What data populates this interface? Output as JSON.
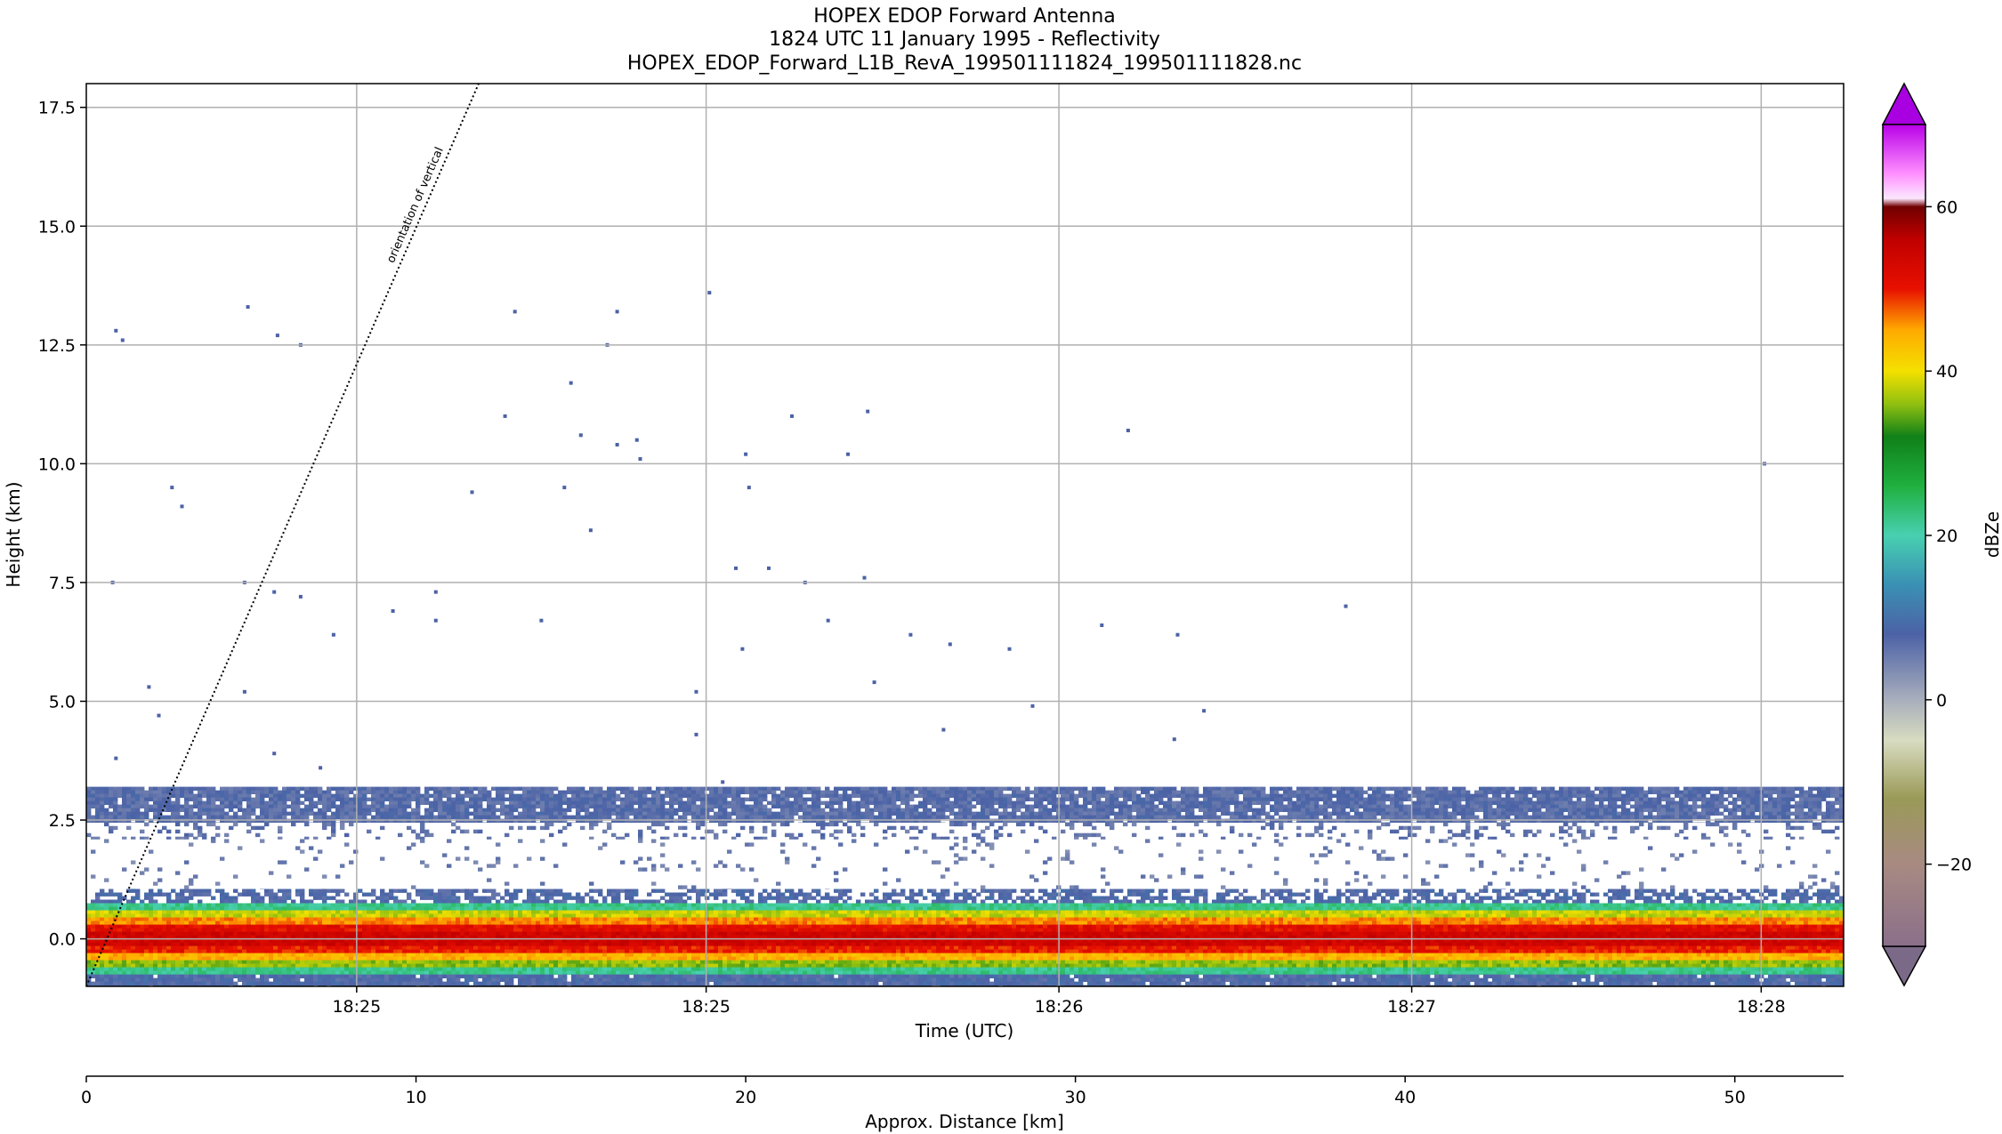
{
  "chart_data": {
    "type": "heatmap",
    "title_lines": [
      "HOPEX EDOP Forward Antenna",
      "1824 UTC 11 January 1995 - Reflectivity",
      "HOPEX_EDOP_Forward_L1B_RevA_199501111824_199501111828.nc"
    ],
    "xlabel": "Time (UTC)",
    "ylabel": "Height (km)",
    "x_ticks": [
      {
        "km": 8.2,
        "label": "18:25"
      },
      {
        "km": 18.8,
        "label": "18:25"
      },
      {
        "km": 29.5,
        "label": "18:26"
      },
      {
        "km": 40.2,
        "label": "18:27"
      },
      {
        "km": 50.8,
        "label": "18:28"
      }
    ],
    "distance_axis": {
      "label": "Approx. Distance [km]",
      "range_km": [
        0,
        53.3
      ],
      "ticks": [
        0,
        10,
        20,
        30,
        40,
        50
      ],
      "tick_labels": [
        "0",
        "10",
        "20",
        "30",
        "40",
        "50"
      ]
    },
    "y_range_km": [
      -1.0,
      18.0
    ],
    "y_ticks": [
      0.0,
      2.5,
      5.0,
      7.5,
      10.0,
      12.5,
      15.0,
      17.5
    ],
    "y_tick_labels": [
      "0.0",
      "2.5",
      "5.0",
      "7.5",
      "10.0",
      "12.5",
      "15.0",
      "17.5"
    ],
    "grid": true,
    "colorbar": {
      "label": "dBZe",
      "range": [
        -30,
        70
      ],
      "ticks": [
        -20,
        0,
        20,
        40,
        60
      ],
      "tick_labels": [
        "−20",
        "0",
        "20",
        "40",
        "60"
      ],
      "extend": "both",
      "stops": [
        {
          "v": -30,
          "color": "#8a6f8a"
        },
        {
          "v": -20,
          "color": "#a88a82"
        },
        {
          "v": -12,
          "color": "#9a9a58"
        },
        {
          "v": -5,
          "color": "#d8dcc0"
        },
        {
          "v": 0,
          "color": "#a8aebc"
        },
        {
          "v": 8,
          "color": "#4c62a6"
        },
        {
          "v": 14,
          "color": "#3a90b4"
        },
        {
          "v": 20,
          "color": "#48d0b0"
        },
        {
          "v": 26,
          "color": "#20b040"
        },
        {
          "v": 32,
          "color": "#108018"
        },
        {
          "v": 36,
          "color": "#90c010"
        },
        {
          "v": 40,
          "color": "#f4e000"
        },
        {
          "v": 45,
          "color": "#ffaa00"
        },
        {
          "v": 50,
          "color": "#e81000"
        },
        {
          "v": 56,
          "color": "#c00000"
        },
        {
          "v": 60,
          "color": "#700000"
        },
        {
          "v": 61,
          "color": "#fce8ff"
        },
        {
          "v": 64,
          "color": "#ff90ff"
        },
        {
          "v": 70,
          "color": "#b800e8"
        }
      ],
      "over_color": "#a800e0",
      "under_color": "#7a6a88"
    },
    "annotation": {
      "text": "orientation of vertical",
      "line_from_km": [
        0,
        -1.0
      ],
      "line_to_km": [
        11.9,
        18.0
      ]
    },
    "layers": [
      {
        "y0": 2.45,
        "y1": 3.2,
        "dbz": 7,
        "density": 0.9
      },
      {
        "y0": 2.1,
        "y1": 2.45,
        "dbz": 6,
        "density": 0.2
      },
      {
        "y0": 1.05,
        "y1": 2.1,
        "dbz": 5,
        "density": 0.05
      },
      {
        "y0": 0.75,
        "y1": 1.05,
        "dbz": 8,
        "density": 0.6
      },
      {
        "y0": 0.6,
        "y1": 0.75,
        "dbz": 22,
        "density": 1.0
      },
      {
        "y0": 0.45,
        "y1": 0.6,
        "dbz": 38,
        "density": 1.0
      },
      {
        "y0": 0.3,
        "y1": 0.45,
        "dbz": 46,
        "density": 1.0
      },
      {
        "y0": 0.15,
        "y1": 0.3,
        "dbz": 51,
        "density": 1.0
      },
      {
        "y0": -0.15,
        "y1": 0.15,
        "dbz": 54,
        "density": 1.0
      },
      {
        "y0": -0.3,
        "y1": -0.15,
        "dbz": 50,
        "density": 1.0
      },
      {
        "y0": -0.45,
        "y1": -0.3,
        "dbz": 44,
        "density": 1.0
      },
      {
        "y0": -0.6,
        "y1": -0.45,
        "dbz": 36,
        "density": 1.0
      },
      {
        "y0": -0.75,
        "y1": -0.6,
        "dbz": 22,
        "density": 1.0
      },
      {
        "y0": -1.0,
        "y1": -0.75,
        "dbz": 8,
        "density": 0.95
      }
    ],
    "speckles_km": [
      [
        0.9,
        12.8
      ],
      [
        1.1,
        12.6
      ],
      [
        0.8,
        7.5
      ],
      [
        0.9,
        3.8
      ],
      [
        1.9,
        5.3
      ],
      [
        2.2,
        4.7
      ],
      [
        2.6,
        9.5
      ],
      [
        2.9,
        9.1
      ],
      [
        4.9,
        13.3
      ],
      [
        4.8,
        7.5
      ],
      [
        4.8,
        5.2
      ],
      [
        5.8,
        12.7
      ],
      [
        5.7,
        7.3
      ],
      [
        5.7,
        3.9
      ],
      [
        6.5,
        12.5
      ],
      [
        6.5,
        7.2
      ],
      [
        7.1,
        3.6
      ],
      [
        7.5,
        6.4
      ],
      [
        9.3,
        6.9
      ],
      [
        10.6,
        7.3
      ],
      [
        10.6,
        6.7
      ],
      [
        11.7,
        9.4
      ],
      [
        12.7,
        11.0
      ],
      [
        13.0,
        13.2
      ],
      [
        13.8,
        6.7
      ],
      [
        14.5,
        9.5
      ],
      [
        14.7,
        11.7
      ],
      [
        15.0,
        10.6
      ],
      [
        15.3,
        8.6
      ],
      [
        15.8,
        12.5
      ],
      [
        16.1,
        13.2
      ],
      [
        16.1,
        10.4
      ],
      [
        16.7,
        10.5
      ],
      [
        16.8,
        10.1
      ],
      [
        18.5,
        5.2
      ],
      [
        18.5,
        4.3
      ],
      [
        18.9,
        13.6
      ],
      [
        19.3,
        3.3
      ],
      [
        19.7,
        7.8
      ],
      [
        19.9,
        6.1
      ],
      [
        20.0,
        10.2
      ],
      [
        20.1,
        9.5
      ],
      [
        20.7,
        7.8
      ],
      [
        21.4,
        11.0
      ],
      [
        21.8,
        7.5
      ],
      [
        22.5,
        6.7
      ],
      [
        23.1,
        10.2
      ],
      [
        23.6,
        7.6
      ],
      [
        23.7,
        11.1
      ],
      [
        23.9,
        5.4
      ],
      [
        25.0,
        6.4
      ],
      [
        26.0,
        4.4
      ],
      [
        26.2,
        6.2
      ],
      [
        28.0,
        6.1
      ],
      [
        28.7,
        4.9
      ],
      [
        30.8,
        6.6
      ],
      [
        31.6,
        10.7
      ],
      [
        33.0,
        4.2
      ],
      [
        33.1,
        6.4
      ],
      [
        33.9,
        4.8
      ],
      [
        38.2,
        7.0
      ],
      [
        50.9,
        10.0
      ]
    ]
  }
}
